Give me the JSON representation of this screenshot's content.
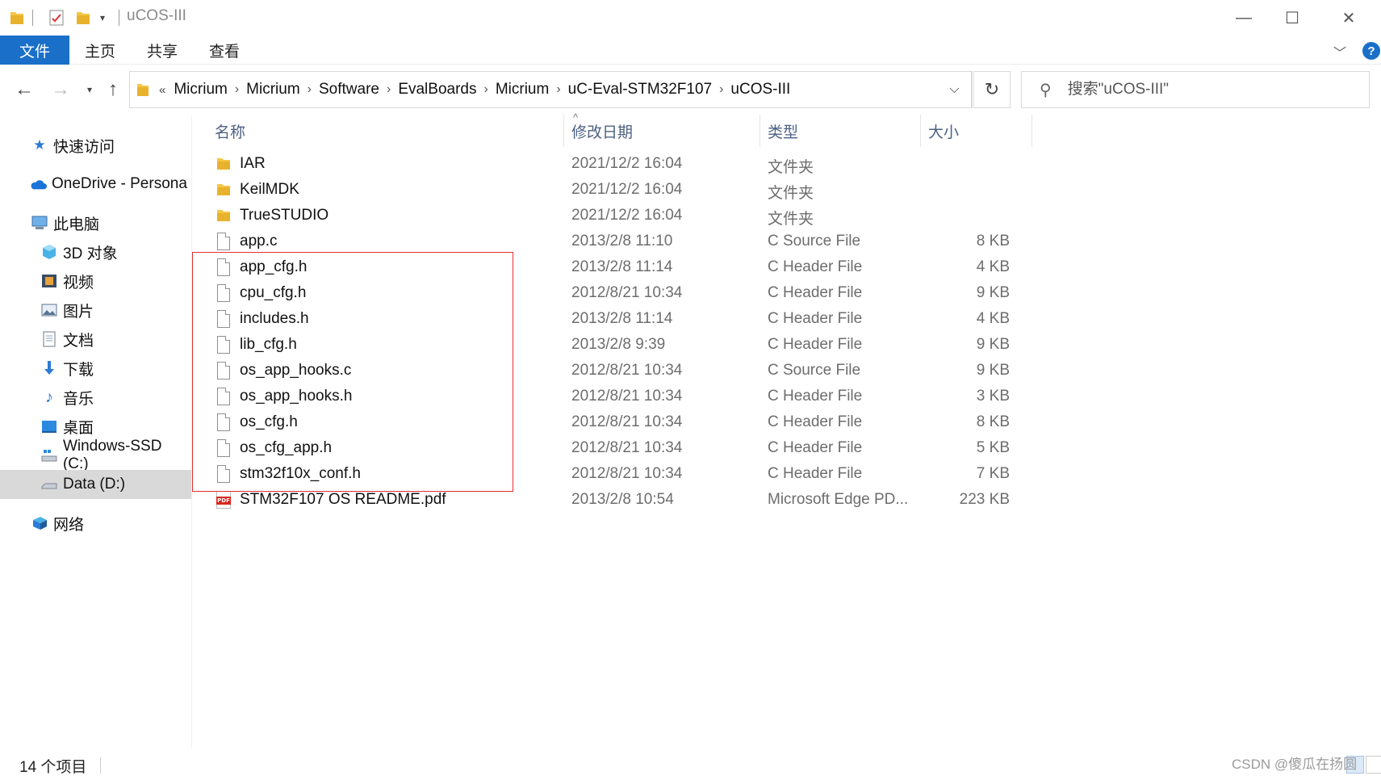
{
  "window": {
    "title": "uCOS-III",
    "minimize_glyph": "—",
    "maximize_glyph": "☐",
    "close_glyph": "✕"
  },
  "ribbon": {
    "file_tab": "文件",
    "tabs": [
      "主页",
      "共享",
      "查看"
    ],
    "help_glyph": "?"
  },
  "address": {
    "overflow": "«",
    "crumbs": [
      "Micrium",
      "Micrium",
      "Software",
      "EvalBoards",
      "Micrium",
      "uC-Eval-STM32F107",
      "uCOS-III"
    ],
    "search_placeholder": "搜索\"uCOS-III\""
  },
  "nav": {
    "items": [
      {
        "label": "快速访问",
        "icon": "star-icon"
      },
      {
        "label": "OneDrive - Persona",
        "icon": "cloud-icon"
      },
      {
        "label": "此电脑",
        "icon": "computer-icon"
      },
      {
        "label": "3D 对象",
        "icon": "cube-icon"
      },
      {
        "label": "视频",
        "icon": "video-icon"
      },
      {
        "label": "图片",
        "icon": "picture-icon"
      },
      {
        "label": "文档",
        "icon": "document-icon"
      },
      {
        "label": "下载",
        "icon": "download-icon"
      },
      {
        "label": "音乐",
        "icon": "music-icon"
      },
      {
        "label": "桌面",
        "icon": "desktop-icon"
      },
      {
        "label": "Windows-SSD (C:)",
        "icon": "drive-icon"
      },
      {
        "label": "Data (D:)",
        "icon": "drive-icon",
        "selected": true
      },
      {
        "label": "网络",
        "icon": "network-icon"
      }
    ]
  },
  "columns": {
    "name": "名称",
    "date": "修改日期",
    "type": "类型",
    "size": "大小"
  },
  "files": [
    {
      "name": "IAR",
      "date": "2021/12/2 16:04",
      "type": "文件夹",
      "size": "",
      "kind": "folder"
    },
    {
      "name": "KeilMDK",
      "date": "2021/12/2 16:04",
      "type": "文件夹",
      "size": "",
      "kind": "folder"
    },
    {
      "name": "TrueSTUDIO",
      "date": "2021/12/2 16:04",
      "type": "文件夹",
      "size": "",
      "kind": "folder"
    },
    {
      "name": "app.c",
      "date": "2013/2/8 11:10",
      "type": "C Source File",
      "size": "8 KB",
      "kind": "file"
    },
    {
      "name": "app_cfg.h",
      "date": "2013/2/8 11:14",
      "type": "C Header File",
      "size": "4 KB",
      "kind": "file"
    },
    {
      "name": "cpu_cfg.h",
      "date": "2012/8/21 10:34",
      "type": "C Header File",
      "size": "9 KB",
      "kind": "file"
    },
    {
      "name": "includes.h",
      "date": "2013/2/8 11:14",
      "type": "C Header File",
      "size": "4 KB",
      "kind": "file"
    },
    {
      "name": "lib_cfg.h",
      "date": "2013/2/8 9:39",
      "type": "C Header File",
      "size": "9 KB",
      "kind": "file"
    },
    {
      "name": "os_app_hooks.c",
      "date": "2012/8/21 10:34",
      "type": "C Source File",
      "size": "9 KB",
      "kind": "file"
    },
    {
      "name": "os_app_hooks.h",
      "date": "2012/8/21 10:34",
      "type": "C Header File",
      "size": "3 KB",
      "kind": "file"
    },
    {
      "name": "os_cfg.h",
      "date": "2012/8/21 10:34",
      "type": "C Header File",
      "size": "8 KB",
      "kind": "file"
    },
    {
      "name": "os_cfg_app.h",
      "date": "2012/8/21 10:34",
      "type": "C Header File",
      "size": "5 KB",
      "kind": "file"
    },
    {
      "name": "stm32f10x_conf.h",
      "date": "2012/8/21 10:34",
      "type": "C Header File",
      "size": "7 KB",
      "kind": "file"
    },
    {
      "name": "STM32F107 OS README.pdf",
      "date": "2013/2/8 10:54",
      "type": "Microsoft Edge PD...",
      "size": "223 KB",
      "kind": "pdf"
    }
  ],
  "status": {
    "count": "14 个项目"
  },
  "watermark": "CSDN @傻瓜在扬圆",
  "colors": {
    "accent": "#1a6fc9",
    "highlight_box": "#e03030",
    "folder": "#f6c745",
    "selected_nav": "#d9d9d9"
  }
}
